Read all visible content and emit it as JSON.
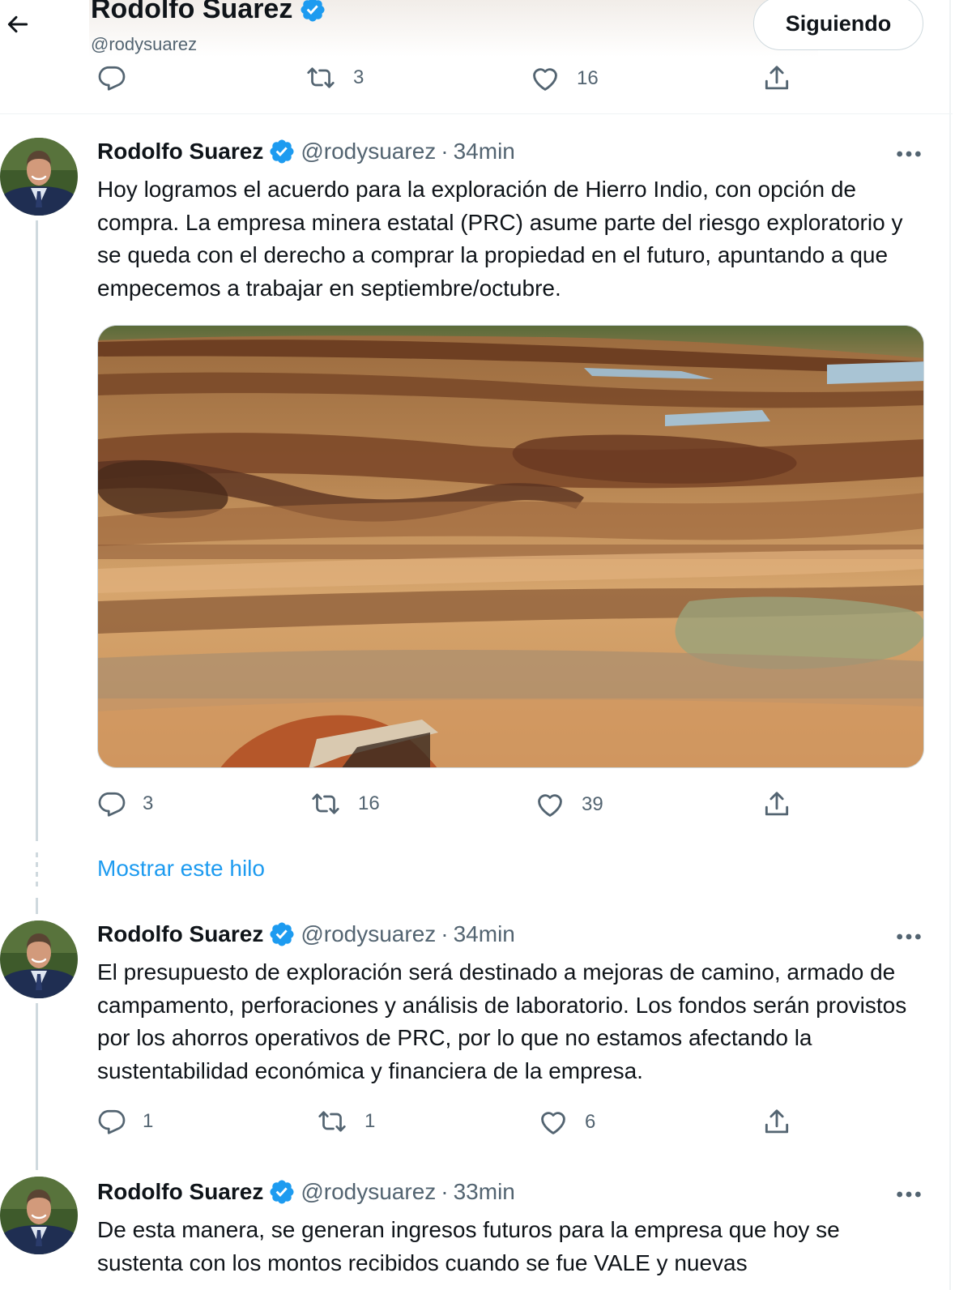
{
  "header": {
    "name": "Rodolfo Suarez",
    "handle": "@rodysuarez",
    "follow_label": "Siguiendo"
  },
  "top_actions": {
    "reply": "",
    "retweet": "3",
    "like": "16"
  },
  "tweets": [
    {
      "name": "Rodolfo Suarez",
      "handle": "@rodysuarez",
      "dot": "·",
      "time": "34min",
      "text": "Hoy logramos el acuerdo para la exploración de Hierro Indio, con opción de compra. La empresa minera estatal (PRC) asume parte del riesgo exploratorio y se queda con el derecho a comprar la propiedad en el futuro, apuntando a que empecemos a trabajar en septiembre/octubre.",
      "replies": "3",
      "retweets": "16",
      "likes": "39"
    },
    {
      "name": "Rodolfo Suarez",
      "handle": "@rodysuarez",
      "dot": "·",
      "time": "34min",
      "text": "El presupuesto de exploración será destinado a mejoras de camino, armado de campamento, perforaciones y análisis de laboratorio. Los fondos serán provistos por los ahorros operativos de PRC, por lo que no estamos afectando la sustentabilidad económica y financiera de la empresa.",
      "replies": "1",
      "retweets": "1",
      "likes": "6"
    },
    {
      "name": "Rodolfo Suarez",
      "handle": "@rodysuarez",
      "dot": "·",
      "time": "33min",
      "text": "De esta manera, se generan ingresos futuros para la empresa que hoy se sustenta con los montos recibidos cuando se fue VALE y nuevas"
    }
  ],
  "show_thread_label": "Mostrar este hilo",
  "colors": {
    "accent": "#1d9bf0",
    "secondary_text": "#536471",
    "verified": "#1d9bf0"
  }
}
